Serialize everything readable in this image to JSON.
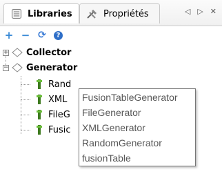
{
  "tabs": [
    {
      "label": "Libraries",
      "icon": "library-icon",
      "active": true
    },
    {
      "label": "Propriétés",
      "icon": "tools-icon",
      "active": false
    }
  ],
  "tab_controls": {
    "prev": "◁",
    "next": "▷",
    "close": "✕"
  },
  "toolbar": {
    "add": "+",
    "remove": "−",
    "refresh": "⟳",
    "help": "?"
  },
  "tree": {
    "nodes": [
      {
        "label": "Collector",
        "icon": "diamond-icon",
        "expanded": false
      },
      {
        "label": "Generator",
        "icon": "diamond-icon",
        "expanded": true,
        "children": [
          {
            "label": "Rand"
          },
          {
            "label": "XML"
          },
          {
            "label": "FileG"
          },
          {
            "label": "Fusic"
          }
        ]
      }
    ]
  },
  "tooltip": {
    "items": [
      "FusionTableGenerator",
      "FileGenerator",
      "XMLGenerator",
      "RandomGenerator",
      "fusionTable"
    ]
  }
}
